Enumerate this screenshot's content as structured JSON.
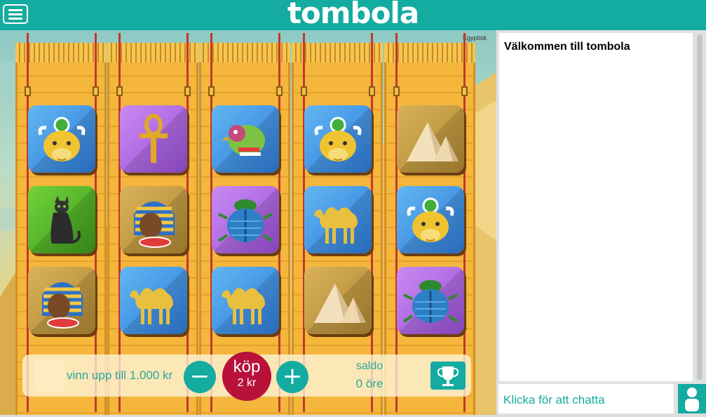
{
  "header": {
    "logo": "tombola",
    "menu_icon": "hamburger-icon"
  },
  "game": {
    "theme_label": "Egyptisk",
    "symbols": [
      [
        "bull",
        "ankh",
        "bird",
        "bull",
        "pyramid"
      ],
      [
        "cat",
        "pharaoh",
        "scarab",
        "camel",
        "bull"
      ],
      [
        "pharaoh",
        "camel",
        "camel",
        "pyramid",
        "scarab"
      ]
    ],
    "controls": {
      "win_text": "vinn upp till 1.000 kr",
      "minus": "−",
      "plus": "+",
      "buy_label": "köp",
      "buy_price": "2 kr",
      "saldo_label": "saldo",
      "saldo_value": "0 öre",
      "trophy_icon": "trophy-icon"
    },
    "colors": {
      "brand": "#14aba0",
      "buy": "#b8123b"
    }
  },
  "chat": {
    "welcome": "Välkommen till tombola",
    "input_placeholder": "Klicka för att chatta",
    "user_icon": "user-icon"
  }
}
